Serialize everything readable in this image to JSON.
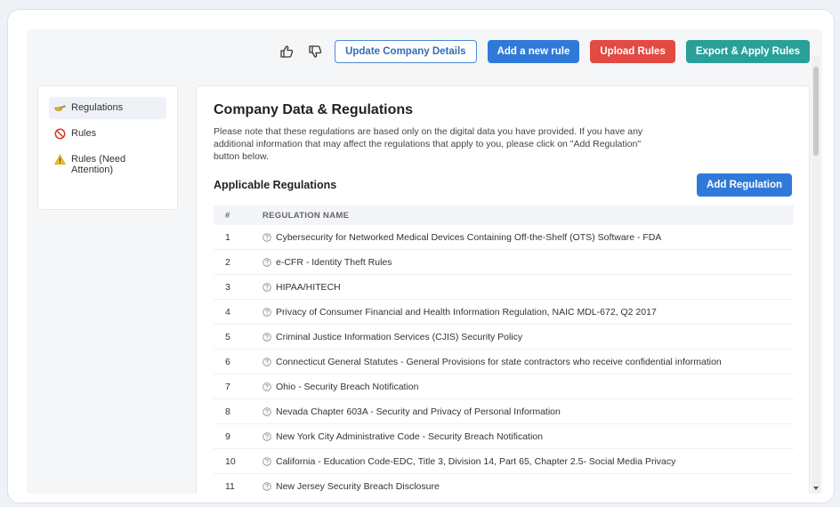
{
  "toolbar": {
    "update_label": "Update Company Details",
    "add_rule_label": "Add a new rule",
    "upload_label": "Upload Rules",
    "export_label": "Export & Apply Rules"
  },
  "sidebar": {
    "items": [
      {
        "label": "Regulations",
        "icon": "hand-pointing-icon"
      },
      {
        "label": "Rules",
        "icon": "no-entry-icon"
      },
      {
        "label": "Rules (Need Attention)",
        "icon": "warning-icon"
      }
    ]
  },
  "main": {
    "title": "Company Data & Regulations",
    "note": "Please note that these regulations are based only on the digital data you have provided. If you have any additional information that may affect the regulations that apply to you, please click on \"Add Regulation\" button below.",
    "section_title": "Applicable Regulations",
    "add_regulation_label": "Add Regulation",
    "table": {
      "headers": [
        "#",
        "REGULATION NAME"
      ],
      "rows": [
        {
          "num": "1",
          "name": "Cybersecurity for Networked Medical Devices Containing Off-the-Shelf (OTS) Software - FDA"
        },
        {
          "num": "2",
          "name": "e-CFR - Identity Theft Rules"
        },
        {
          "num": "3",
          "name": "HIPAA/HITECH"
        },
        {
          "num": "4",
          "name": "Privacy of Consumer Financial and Health Information Regulation, NAIC MDL-672, Q2 2017"
        },
        {
          "num": "5",
          "name": "Criminal Justice Information Services (CJIS) Security Policy"
        },
        {
          "num": "6",
          "name": "Connecticut General Statutes - General Provisions for state contractors who receive confidential information"
        },
        {
          "num": "7",
          "name": "Ohio - Security Breach Notification"
        },
        {
          "num": "8",
          "name": "Nevada Chapter 603A - Security and Privacy of Personal Information"
        },
        {
          "num": "9",
          "name": "New York City Administrative Code - Security Breach Notification"
        },
        {
          "num": "10",
          "name": "California - Education Code-EDC, Title 3, Division 14, Part 65, Chapter 2.5- Social Media Privacy"
        },
        {
          "num": "11",
          "name": "New Jersey Security Breach Disclosure"
        }
      ]
    }
  },
  "colors": {
    "primary_blue": "#2f7ad8",
    "danger_red": "#e24a42",
    "teal": "#29a09a"
  }
}
